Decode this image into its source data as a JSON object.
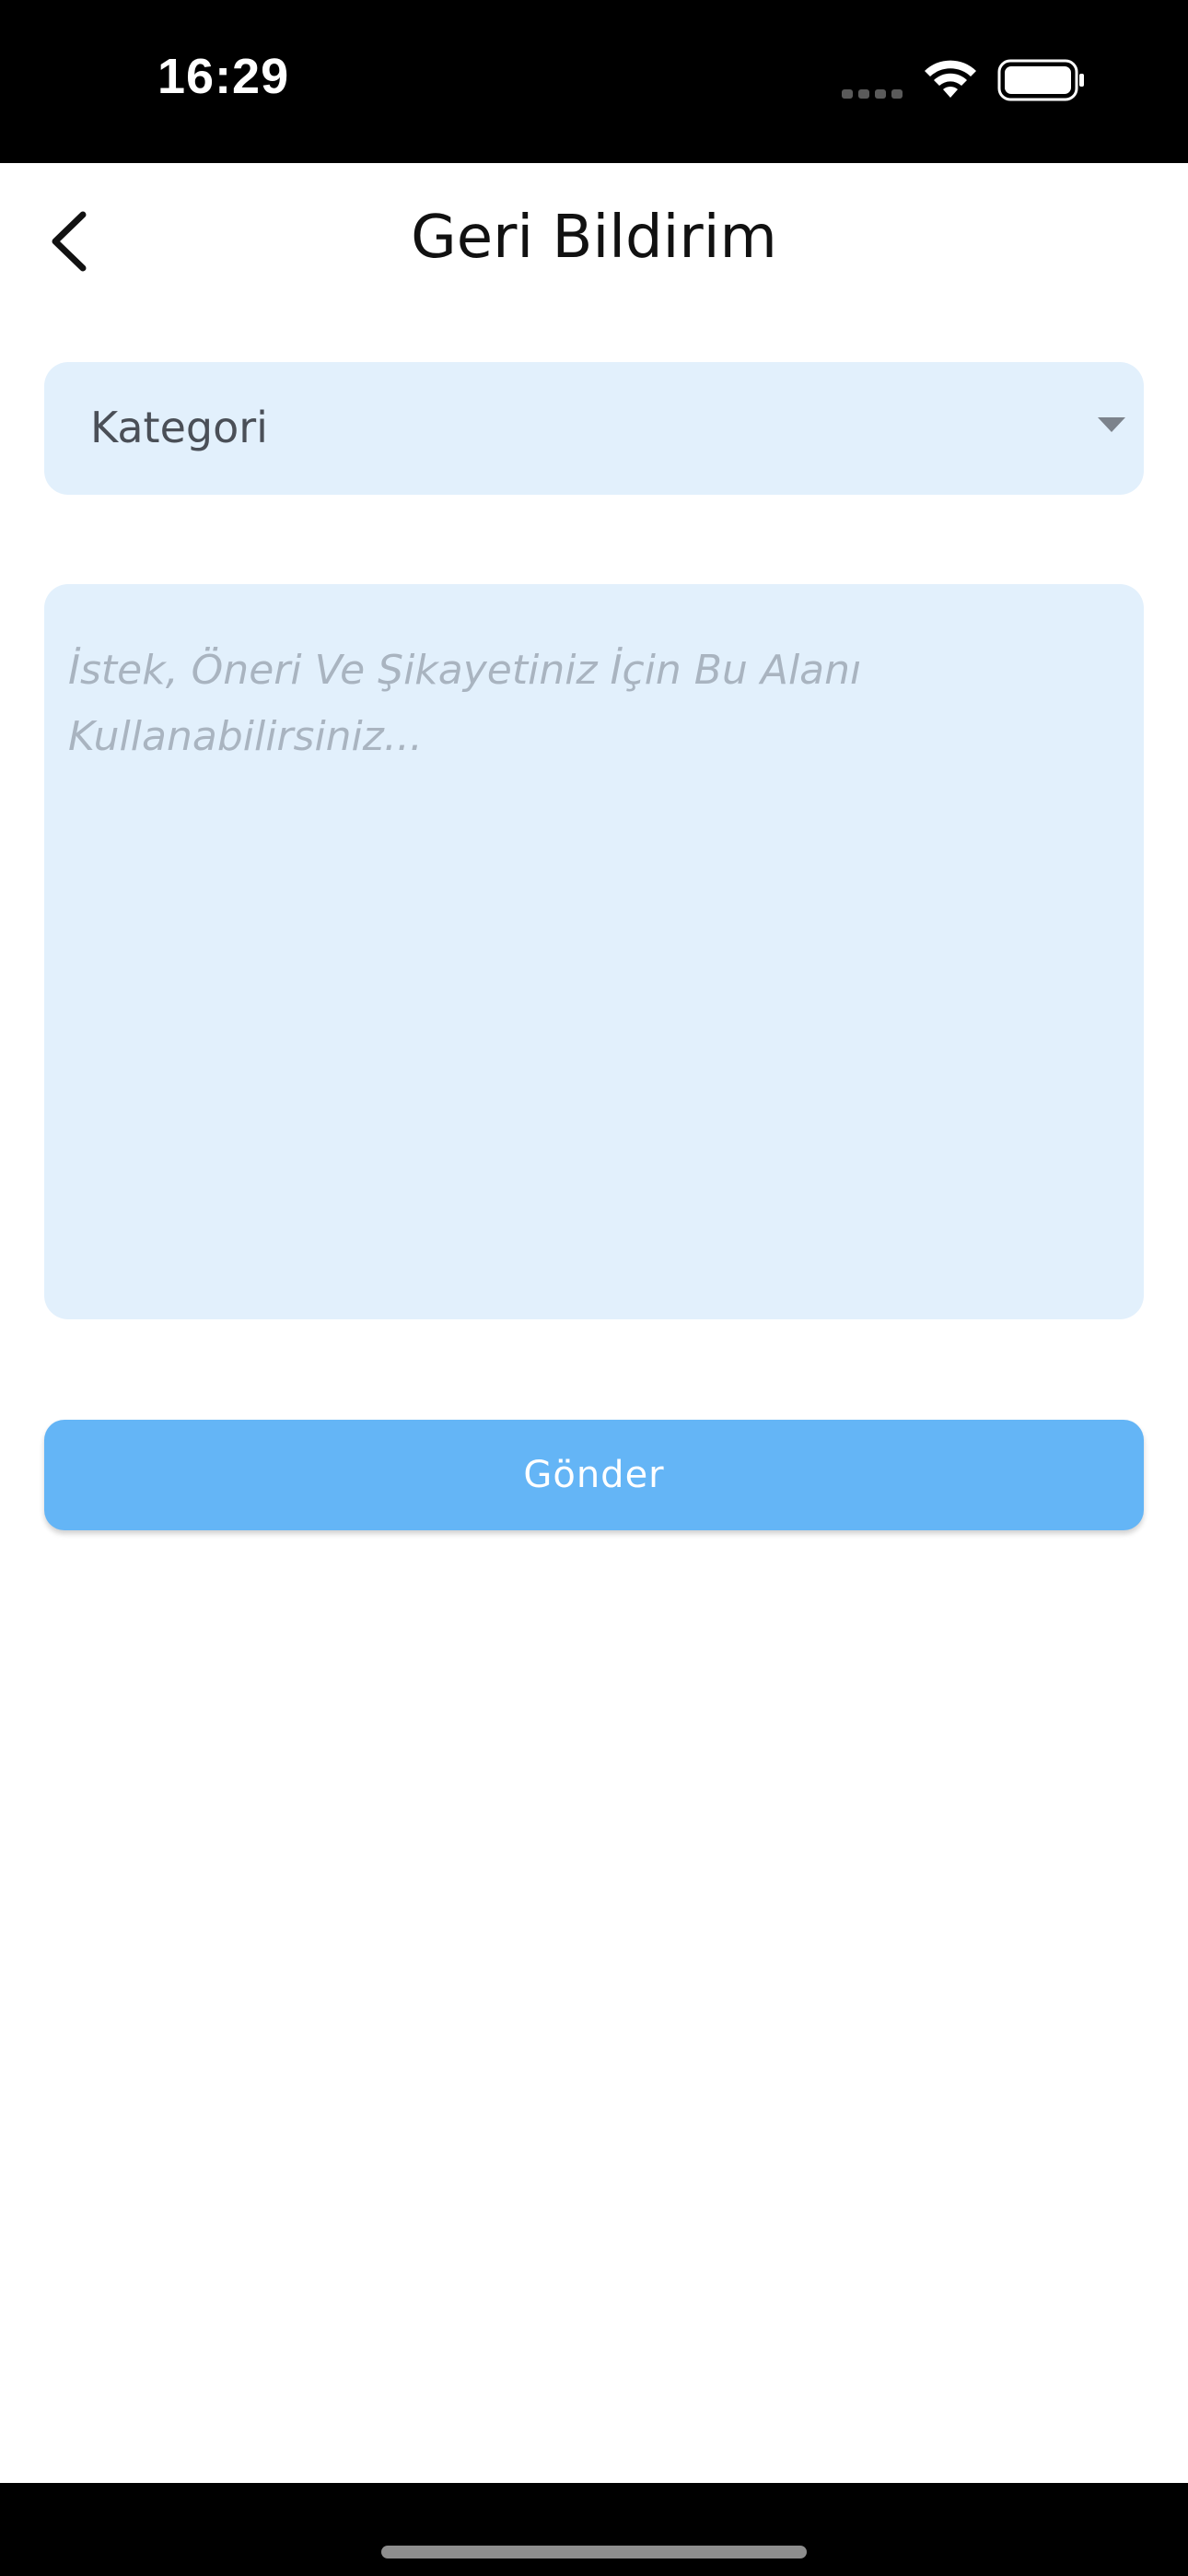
{
  "status_bar": {
    "time": "16:29",
    "icons": [
      "signal-dots-icon",
      "wifi-icon",
      "battery-icon"
    ]
  },
  "header": {
    "title": "Geri Bildirim",
    "back_icon": "chevron-left-icon"
  },
  "form": {
    "category": {
      "label": "Kategori",
      "icon": "dropdown-arrow-icon"
    },
    "message": {
      "value": "",
      "placeholder": "İstek, Öneri Ve Şikayetiniz İçin Bu Alanı Kullanabilirsiniz..."
    },
    "submit_label": "Gönder"
  },
  "colors": {
    "field_background": "#e2f0fc",
    "button_background": "#64b5f6",
    "placeholder": "#a9b4c0",
    "title": "#111111"
  }
}
